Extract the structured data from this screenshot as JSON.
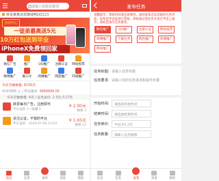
{
  "left": {
    "search_placeholder": "请输入标题关键词",
    "notice": "恭喜某某派单赚钱鸭QQ123",
    "banner": {
      "logo": "活动中心",
      "line1": "一徒弟最高送5元",
      "line2": "10万红包送到毕业",
      "line3": "iPhoneX免费领回家"
    },
    "grid": [
      {
        "label": "微信广告",
        "color": "#e9473a"
      },
      {
        "label": "推广",
        "color": "#f39a19"
      },
      {
        "label": "QQ推广",
        "color": "#3b7ee8"
      },
      {
        "label": "注册认证",
        "color": "#e9473a"
      },
      {
        "label": "网站投票",
        "color": "#f39a19"
      },
      {
        "label": "微博推广",
        "color": "#3b7ee8"
      },
      {
        "label": "集口令",
        "color": "#e9473a"
      },
      {
        "label": "闲赚推广",
        "color": "#f39a19"
      },
      {
        "label": "网店推广",
        "color": "#3b7ee8"
      },
      {
        "label": "同城推广",
        "color": "#e9473a"
      }
    ],
    "stats": {
      "line1": "今天可做数量: 8236次",
      "line2_prefix": "9293886 人 | 昨日最多: ",
      "line2_value": "9999999.00",
      "line3": "今天可做数量: 4次 | 任务总价: 2.5元 0.17元"
    },
    "tasks": [
      {
        "title": "转发每日广告，注册即可",
        "sub": "不认证的 1 | 收藏 2",
        "price": "¥ 2.00元",
        "remain": "剩余 3"
      },
      {
        "title": "关注认证，不错的平台",
        "sub": "不认证的 · 2020-07-04 21:03",
        "price": "¥ 1.65元",
        "remain": "剩余 12"
      }
    ],
    "tabs": [
      {
        "label": "首页",
        "active": true
      },
      {
        "label": "任务",
        "active": false
      },
      {
        "label": "发布",
        "active": false
      },
      {
        "label": "消息",
        "active": false
      },
      {
        "label": "我的",
        "active": false
      }
    ]
  },
  "right": {
    "title": "发布任务",
    "desc": "温馨提示：审核时间请注意事项，请勿发布违法违规的任务内容，发布后平台会进行审核，审核通过后任务才会在平台上展示，请如实填写任务要求。",
    "tags": [
      {
        "label": "微信推广",
        "on": true
      },
      {
        "label": "QQ推广",
        "on": false
      },
      {
        "label": "注册认证",
        "on": false
      },
      {
        "label": "网站投票",
        "on": false
      },
      {
        "label": "闲赚推广",
        "on": false
      },
      {
        "label": "下载任务",
        "on": false
      },
      {
        "label": "网店推广",
        "on": false
      },
      {
        "label": "同城推广",
        "on": false
      },
      {
        "label": "网站推广",
        "on": false
      }
    ],
    "form": {
      "task_title_label": "任务标题:",
      "task_title_placeholder": "请输入任务标题",
      "task_require_label": "任务要求:",
      "task_require_placeholder": "请输入你的任务需求和操作步骤",
      "start_label": "开始时间:",
      "start_placeholder": "请选择开始时间",
      "end_label": "结束时间:",
      "end_placeholder": "请选择结束时间",
      "price_label": "任务单价:",
      "price_placeholder": "不低于0.2元",
      "count_label": "任务数量:",
      "count_placeholder": "请输入任务数量"
    },
    "tabs": [
      {
        "label": "首页",
        "active": false
      },
      {
        "label": "任务",
        "active": false
      },
      {
        "label": "发布",
        "active": true
      },
      {
        "label": "消息",
        "active": false
      },
      {
        "label": "我的",
        "active": false
      }
    ]
  },
  "colors": {
    "accent": "#e9473a",
    "orange": "#f39a19",
    "blue": "#3b7ee8"
  }
}
